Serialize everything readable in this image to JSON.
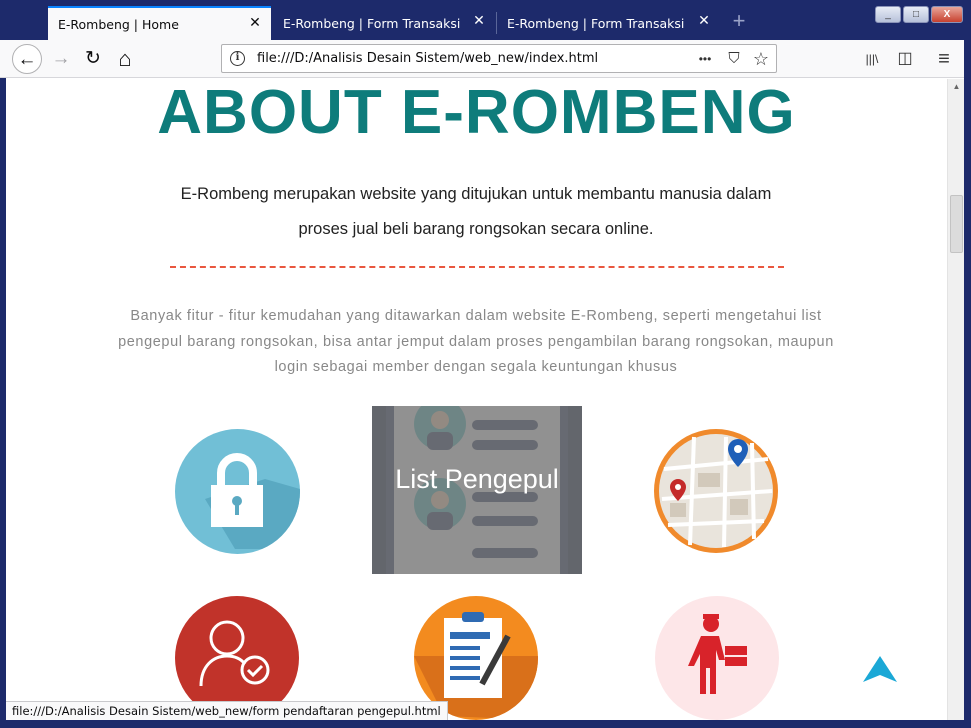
{
  "browser": {
    "tabs": [
      {
        "title": "E-Rombeng | Home",
        "active": true
      },
      {
        "title": "E-Rombeng | Form Transaksi",
        "active": false
      },
      {
        "title": "E-Rombeng | Form Transaksi",
        "active": false
      }
    ],
    "new_tab": "+",
    "close_glyph": "✕",
    "url": "file:///D:/Analisis Desain Sistem/web_new/index.html",
    "status_url": "file:///D:/Analisis Desain Sistem/web_new/form pendaftaran pengepul.html",
    "icons": {
      "back": "←",
      "forward": "→",
      "reload": "↻",
      "home": "⌂",
      "more": "•••",
      "pocket": "⛉",
      "star": "☆",
      "library": "|||\\",
      "sidebar": "◫",
      "menu": "≡",
      "minimize": "_",
      "maximize": "□",
      "close": "X"
    }
  },
  "page": {
    "title": "ABOUT E-ROMBENG",
    "lead_line1": "E-Rombeng merupakan website yang ditujukan untuk membantu manusia dalam",
    "lead_line2": "proses jual beli barang rongsokan secara online.",
    "description": "Banyak fitur - fitur kemudahan yang ditawarkan dalam website E-Rombeng, seperti mengetahui list pengepul barang rongsokan, bisa antar jemput dalam proses pengambilan barang rongsokan, maupun login sebagai member dengan segala keuntungan khusus",
    "features": [
      {
        "icon": "lock-icon"
      },
      {
        "icon": "list-pengepul-card",
        "label": "List Pengepul"
      },
      {
        "icon": "map-icon"
      },
      {
        "icon": "user-check-icon"
      },
      {
        "icon": "clipboard-icon"
      },
      {
        "icon": "delivery-man-icon"
      }
    ]
  },
  "colors": {
    "title": "#0e7c7b",
    "divider": "#e9573f",
    "lock": "#71bfd6",
    "user": "#c1332a",
    "clipboard": "#f38b1f",
    "delivery_bg": "#fde6e8",
    "totop": "#1ba8d6"
  }
}
